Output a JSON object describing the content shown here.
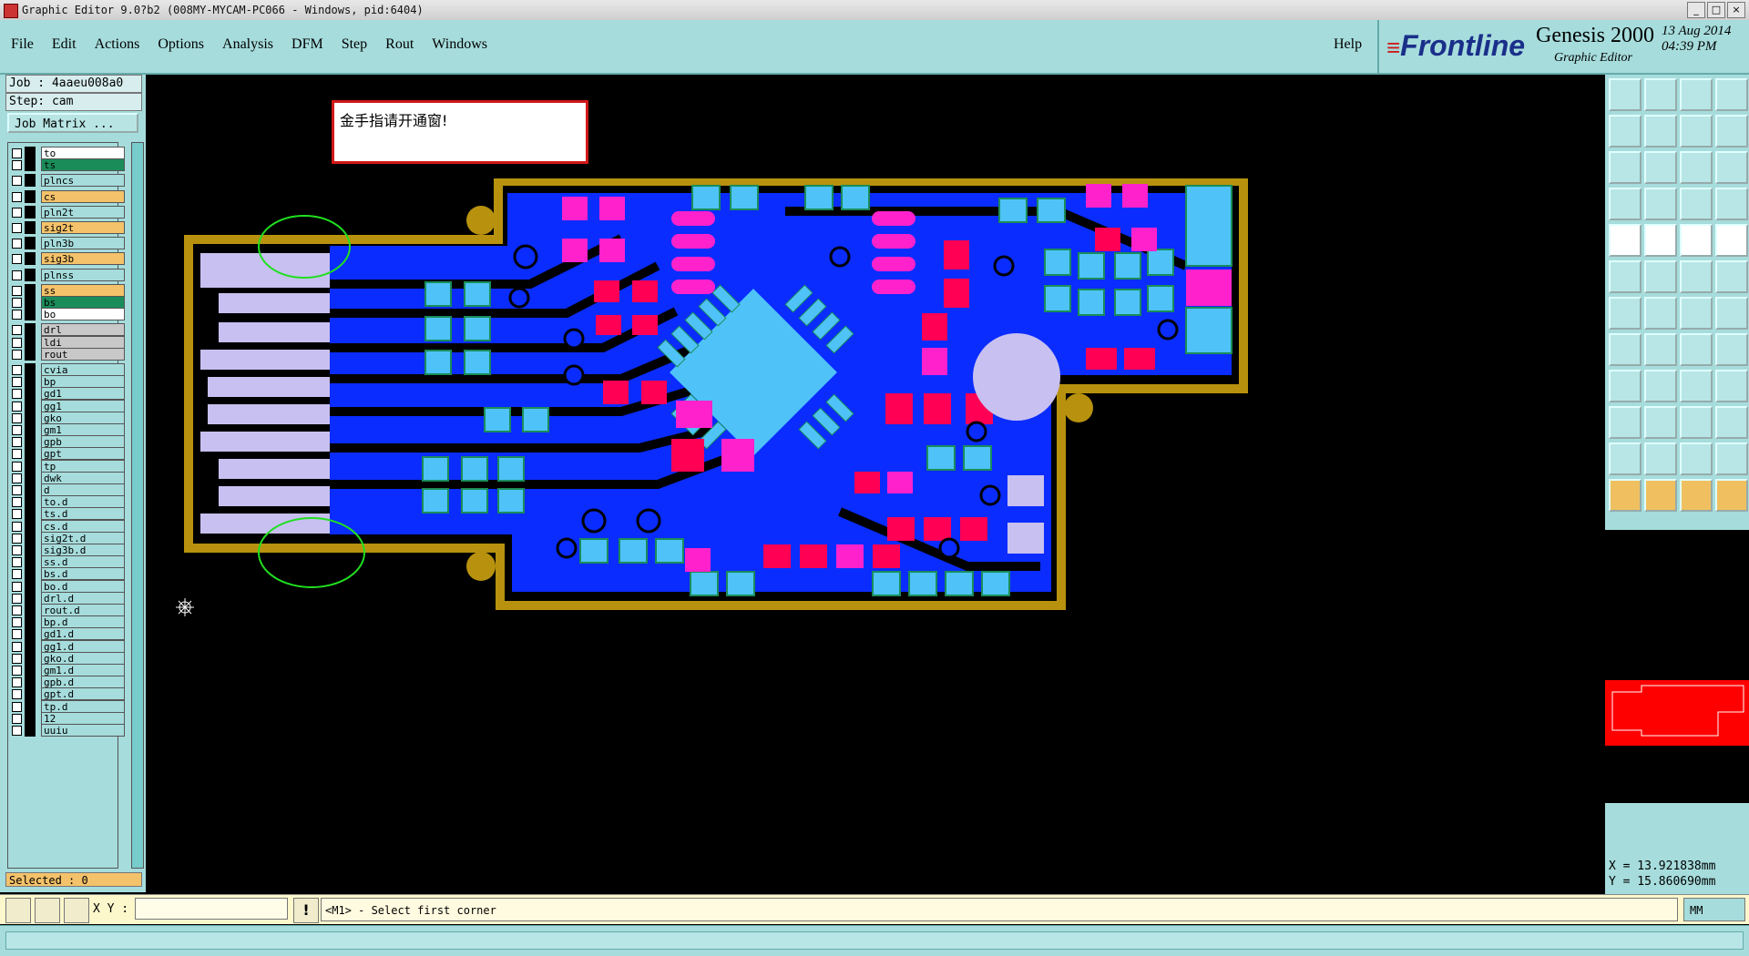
{
  "window": {
    "title": "Graphic Editor 9.0?b2 (008MY-MYCAM-PC066 - Windows, pid:6404)"
  },
  "menu": {
    "items": [
      "File",
      "Edit",
      "Actions",
      "Options",
      "Analysis",
      "DFM",
      "Step",
      "Rout",
      "Windows"
    ],
    "help": "Help"
  },
  "brand": {
    "logo": "Frontline",
    "product": "Genesis 2000",
    "subtitle": "Graphic Editor",
    "date": "13 Aug 2014",
    "time": "04:39 PM"
  },
  "job": {
    "job": "Job : 4aaeu008a0",
    "step": "Step: cam",
    "matrix_button": "Job Matrix ..."
  },
  "layers": [
    {
      "name": "to",
      "color": "#ffffff"
    },
    {
      "name": "ts",
      "color": "#1a8c5a"
    },
    {
      "name": "plncs",
      "color": "#a6dcdc"
    },
    {
      "name": "cs",
      "color": "#f4c26a"
    },
    {
      "name": "pln2t",
      "color": "#a6dcdc"
    },
    {
      "name": "sig2t",
      "color": "#f4c26a"
    },
    {
      "name": "pln3b",
      "color": "#a6dcdc"
    },
    {
      "name": "sig3b",
      "color": "#f4c26a"
    },
    {
      "name": "plnss",
      "color": "#a6dcdc"
    },
    {
      "name": "ss",
      "color": "#f4c26a"
    },
    {
      "name": "bs",
      "color": "#1a8c5a"
    },
    {
      "name": "bo",
      "color": "#ffffff"
    },
    {
      "name": "drl",
      "color": "#c8c8c8"
    },
    {
      "name": "ldi",
      "color": "#c8c8c8"
    },
    {
      "name": "rout",
      "color": "#c8c8c8"
    },
    {
      "name": "cvia",
      "color": "#a6dcdc"
    },
    {
      "name": "bp",
      "color": "#a6dcdc"
    },
    {
      "name": "gd1",
      "color": "#a6dcdc"
    },
    {
      "name": "gg1",
      "color": "#a6dcdc"
    },
    {
      "name": "gko",
      "color": "#a6dcdc"
    },
    {
      "name": "gm1",
      "color": "#a6dcdc"
    },
    {
      "name": "gpb",
      "color": "#a6dcdc"
    },
    {
      "name": "gpt",
      "color": "#a6dcdc"
    },
    {
      "name": "tp",
      "color": "#a6dcdc"
    },
    {
      "name": "dwk",
      "color": "#a6dcdc"
    },
    {
      "name": "d",
      "color": "#a6dcdc"
    },
    {
      "name": "to.d",
      "color": "#a6dcdc"
    },
    {
      "name": "ts.d",
      "color": "#a6dcdc"
    },
    {
      "name": "cs.d",
      "color": "#a6dcdc"
    },
    {
      "name": "sig2t.d",
      "color": "#a6dcdc"
    },
    {
      "name": "sig3b.d",
      "color": "#a6dcdc"
    },
    {
      "name": "ss.d",
      "color": "#a6dcdc"
    },
    {
      "name": "bs.d",
      "color": "#a6dcdc"
    },
    {
      "name": "bo.d",
      "color": "#a6dcdc"
    },
    {
      "name": "drl.d",
      "color": "#a6dcdc"
    },
    {
      "name": "rout.d",
      "color": "#a6dcdc"
    },
    {
      "name": "bp.d",
      "color": "#a6dcdc"
    },
    {
      "name": "gd1.d",
      "color": "#a6dcdc"
    },
    {
      "name": "gg1.d",
      "color": "#a6dcdc"
    },
    {
      "name": "gko.d",
      "color": "#a6dcdc"
    },
    {
      "name": "gm1.d",
      "color": "#a6dcdc"
    },
    {
      "name": "gpb.d",
      "color": "#a6dcdc"
    },
    {
      "name": "gpt.d",
      "color": "#a6dcdc"
    },
    {
      "name": "tp.d",
      "color": "#a6dcdc"
    },
    {
      "name": "12",
      "color": "#a6dcdc"
    },
    {
      "name": "uuiu",
      "color": "#a6dcdc"
    }
  ],
  "selected": "Selected : 0",
  "note": "金手指请开通窗!",
  "coords": {
    "x": "X = 13.921838mm",
    "y": "Y = 15.860690mm"
  },
  "cmd": {
    "xy_label": "X Y :",
    "prompt": "<M1> - Select first corner",
    "units": "MM"
  },
  "colors": {
    "panel": "#a6dcdc",
    "trace": "#0a2cff",
    "pad": "#4fc3f7",
    "smd": "#ff0055",
    "outline": "#b8920e"
  }
}
